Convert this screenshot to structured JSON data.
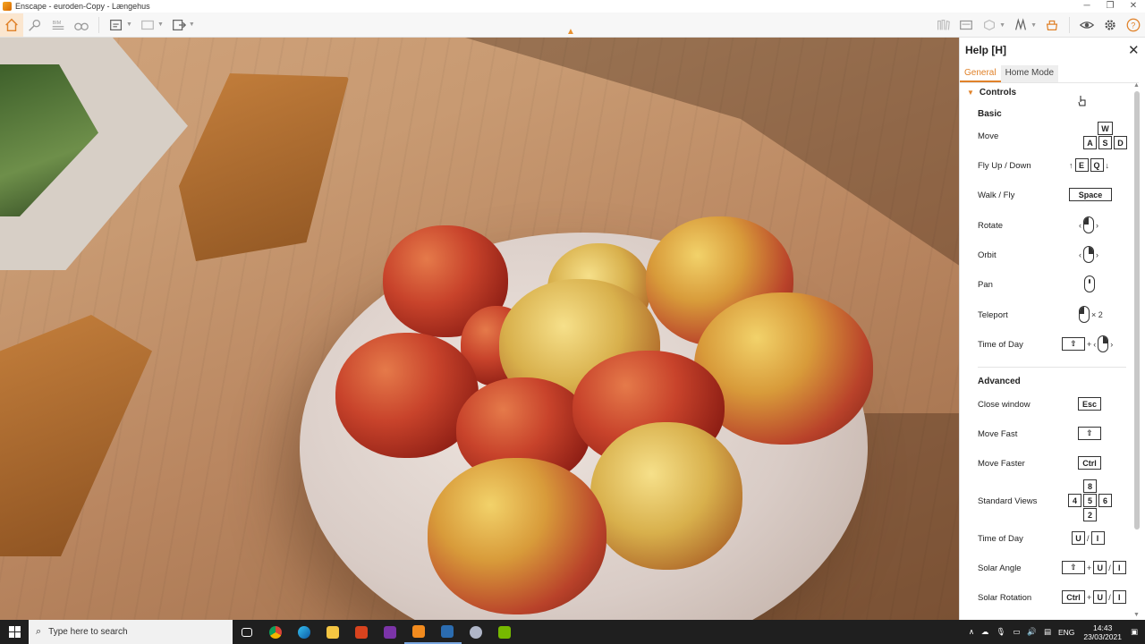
{
  "window": {
    "title": "Enscape - euroden-Copy - Længehus",
    "controls": [
      "─",
      "❐",
      "✕"
    ]
  },
  "toolbar": {
    "left_icons": [
      "home-icon",
      "visual-settings-icon",
      "bim-icon",
      "binoculars-icon",
      "screenshot-icon",
      "batch-render-icon",
      "export-icon"
    ],
    "right_icons": [
      "asset-library-icon",
      "material-editor-icon",
      "model-view-icon",
      "bookmark-icon",
      "collaborate-icon",
      "visibility-icon",
      "settings-icon",
      "help-icon"
    ],
    "accent": "#e0822a"
  },
  "help": {
    "title": "Help [H]",
    "tabs": [
      {
        "label": "General",
        "active": true
      },
      {
        "label": "Home Mode",
        "active": false
      }
    ],
    "section": "Controls",
    "basic": {
      "heading": "Basic",
      "rows": [
        {
          "label": "Move"
        },
        {
          "label": "Fly Up / Down"
        },
        {
          "label": "Walk / Fly"
        },
        {
          "label": "Rotate"
        },
        {
          "label": "Orbit"
        },
        {
          "label": "Pan"
        },
        {
          "label": "Teleport"
        },
        {
          "label": "Time of Day"
        }
      ],
      "keys": {
        "move": [
          "W",
          "A",
          "S",
          "D"
        ],
        "fly": [
          "E",
          "Q"
        ],
        "walk": "Space",
        "teleport_count": "× 2",
        "plus": "+"
      }
    },
    "advanced": {
      "heading": "Advanced",
      "rows": [
        {
          "label": "Close window"
        },
        {
          "label": "Move Fast"
        },
        {
          "label": "Move Faster"
        },
        {
          "label": "Standard Views"
        },
        {
          "label": "Time of Day"
        },
        {
          "label": "Solar Angle"
        },
        {
          "label": "Solar Rotation"
        }
      ],
      "keys": {
        "esc": "Esc",
        "ctrl": "Ctrl",
        "views": [
          "8",
          "4",
          "5",
          "6",
          "2"
        ],
        "u": "U",
        "i": "I",
        "slash": "/",
        "plus": "+"
      }
    }
  },
  "taskbar": {
    "search_placeholder": "Type here to search",
    "apps": [
      {
        "name": "task-view",
        "color": "#ffffff"
      },
      {
        "name": "chrome",
        "color": "#e8b23a"
      },
      {
        "name": "edge",
        "color": "#2fa8d6"
      },
      {
        "name": "file-explorer",
        "color": "#f4c542"
      },
      {
        "name": "office",
        "color": "#d9431e"
      },
      {
        "name": "onenote",
        "color": "#7b34a8"
      },
      {
        "name": "enscape",
        "color": "#f28b1e"
      },
      {
        "name": "revit",
        "color": "#2b6cb0"
      },
      {
        "name": "app-circle",
        "color": "#b0b6c8"
      },
      {
        "name": "nvidia",
        "color": "#76b900"
      }
    ],
    "language": "ENG",
    "time": "14:43",
    "date": "23/03/2021"
  }
}
